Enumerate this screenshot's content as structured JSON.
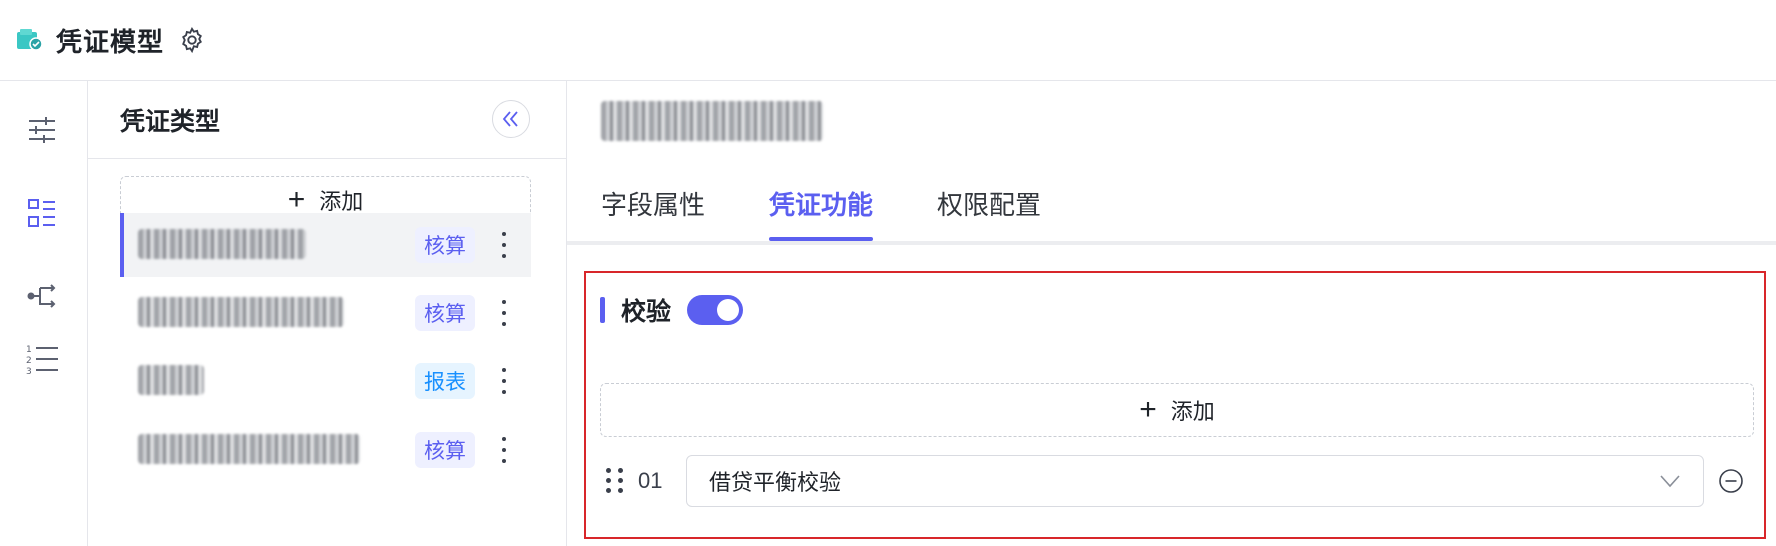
{
  "header": {
    "title": "凭证模型",
    "logo_icon": "voucher-model-logo-icon",
    "settings_icon": "gear-icon"
  },
  "rail": {
    "items": [
      {
        "icon": "sliders-icon",
        "active": false
      },
      {
        "icon": "list-grid-icon",
        "active": true
      },
      {
        "icon": "flow-branch-icon",
        "active": false
      },
      {
        "icon": "ordered-list-icon",
        "active": false
      }
    ]
  },
  "types_panel": {
    "title": "凭证类型",
    "add_label": "添加",
    "items": [
      {
        "name": "",
        "tag": "核算",
        "tag_color": "purple",
        "active": true
      },
      {
        "name": "",
        "tag": "核算",
        "tag_color": "purple",
        "active": false
      },
      {
        "name": "",
        "tag": "报表",
        "tag_color": "blue",
        "active": false
      },
      {
        "name": "",
        "tag": "核算",
        "tag_color": "purple",
        "active": false
      }
    ]
  },
  "detail": {
    "record_title": "",
    "tabs": [
      {
        "label": "字段属性",
        "active": false
      },
      {
        "label": "凭证功能",
        "active": true
      },
      {
        "label": "权限配置",
        "active": false
      }
    ],
    "section": {
      "label": "校验",
      "enabled": true,
      "add_label": "添加",
      "rules": [
        {
          "index": "01",
          "value": "借贷平衡校验"
        }
      ]
    }
  },
  "colors": {
    "accent": "#5b5ff0",
    "highlight_border": "#d8262a",
    "tag_blue": "#1890ff"
  }
}
